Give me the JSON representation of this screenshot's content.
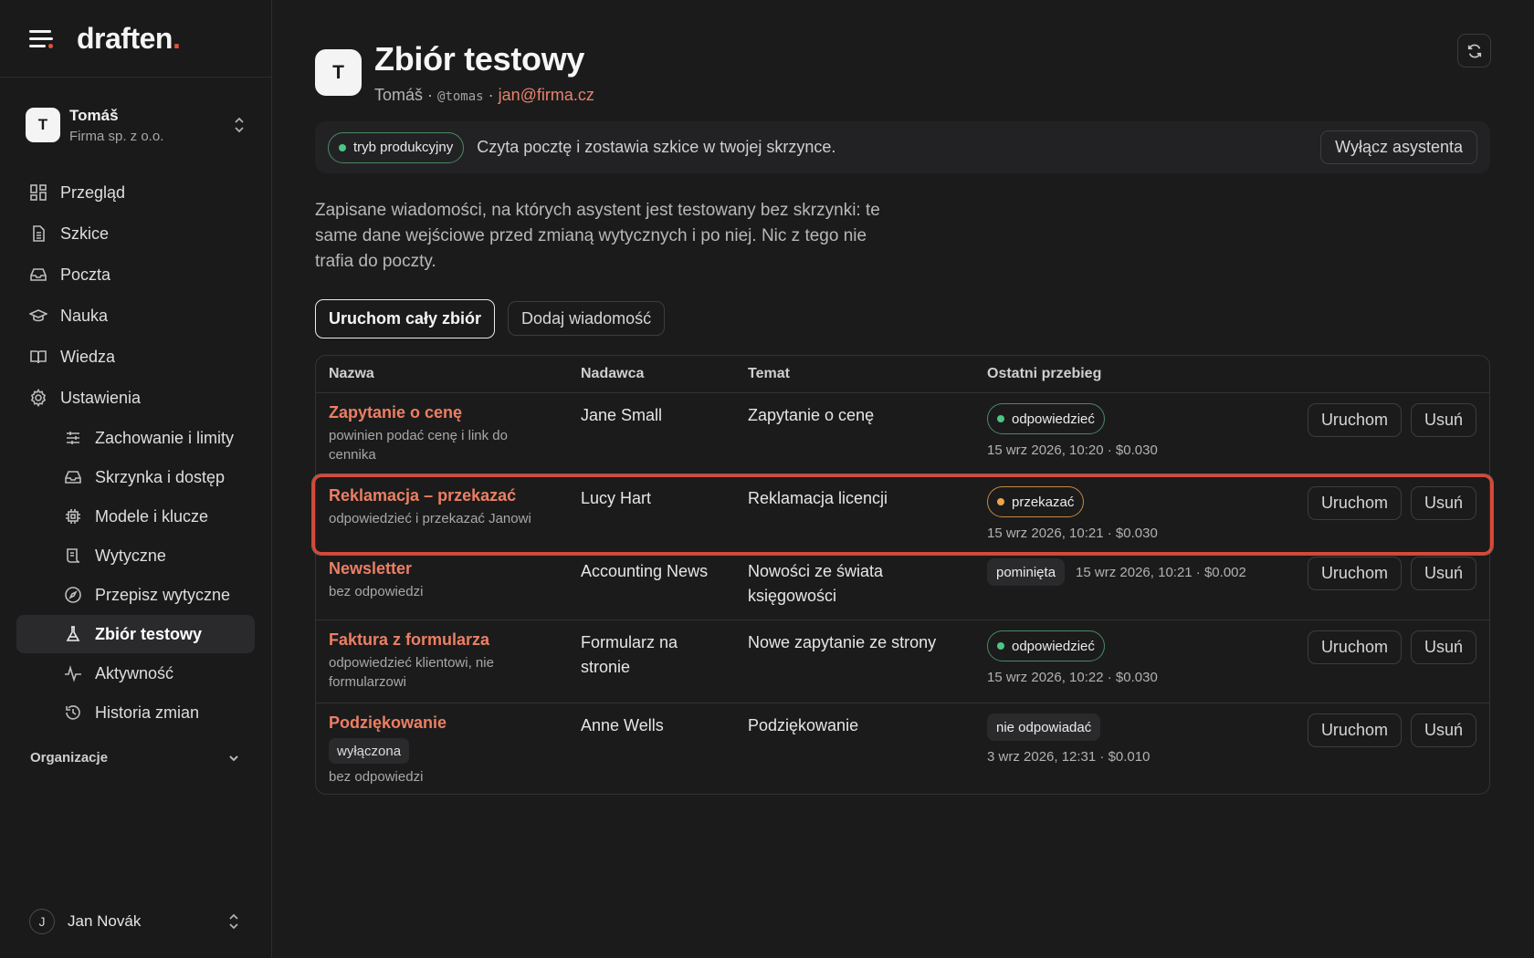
{
  "brand": {
    "name": "draften",
    "dot": "."
  },
  "account": {
    "initial": "T",
    "name": "Tomáš",
    "company": "Firma sp. z o.o."
  },
  "nav": [
    {
      "label": "Przegląd",
      "icon": "grid-icon"
    },
    {
      "label": "Szkice",
      "icon": "file-icon"
    },
    {
      "label": "Poczta",
      "icon": "inbox-icon"
    },
    {
      "label": "Nauka",
      "icon": "graduation-icon"
    },
    {
      "label": "Wiedza",
      "icon": "book-icon"
    },
    {
      "label": "Ustawienia",
      "icon": "gear-icon"
    }
  ],
  "subnav": [
    {
      "label": "Zachowanie i limity",
      "icon": "sliders-icon"
    },
    {
      "label": "Skrzynka i dostęp",
      "icon": "inbox-icon"
    },
    {
      "label": "Modele i klucze",
      "icon": "chip-icon"
    },
    {
      "label": "Wytyczne",
      "icon": "scroll-icon"
    },
    {
      "label": "Przepisz wytyczne",
      "icon": "compass-icon"
    },
    {
      "label": "Zbiór testowy",
      "icon": "flask-icon"
    },
    {
      "label": "Aktywność",
      "icon": "activity-icon"
    },
    {
      "label": "Historia zmian",
      "icon": "history-icon"
    }
  ],
  "org_label": "Organizacje",
  "user": {
    "initial": "J",
    "name": "Jan Novák"
  },
  "page": {
    "initial": "T",
    "title": "Zbiór testowy",
    "owner": "Tomáš",
    "sep": " · ",
    "handle": "@tomas",
    "email": "jan@firma.cz"
  },
  "banner": {
    "mode": "tryb produkcyjny",
    "text": "Czyta pocztę i zostawia szkice w twojej skrzynce.",
    "button": "Wyłącz asystenta"
  },
  "description": "Zapisane wiadomości, na których asystent jest testowany bez skrzynki: te same dane wejściowe przed zmianą wytycznych i po niej. Nic z tego nie trafia do poczty.",
  "actions": {
    "run_all": "Uruchom cały zbiór",
    "add": "Dodaj wiadomość"
  },
  "table": {
    "headers": [
      "Nazwa",
      "Nadawca",
      "Temat",
      "Ostatni przebieg"
    ],
    "run_label": "Uruchom",
    "delete_label": "Usuń",
    "rows": [
      {
        "name": "Zapytanie o cenę",
        "note": "powinien podać cenę i link do cennika",
        "sender": "Jane Small",
        "subject": "Zapytanie o cenę",
        "status": "odpowiedzieć",
        "when": "15 wrz 2026, 10:20 · $0.030"
      },
      {
        "name": "Reklamacja – przekazać",
        "note": "odpowiedzieć i przekazać Janowi",
        "sender": "Lucy Hart",
        "subject": "Reklamacja licencji",
        "status": "przekazać",
        "when": "15 wrz 2026, 10:21 · $0.030"
      },
      {
        "name": "Newsletter",
        "note": "bez odpowiedzi",
        "sender": "Accounting News",
        "subject": "Nowości ze świata księgowości",
        "status": "pominięta",
        "when": "15 wrz 2026, 10:21 · $0.002"
      },
      {
        "name": "Faktura z formularza",
        "note": "odpowiedzieć klientowi, nie formularzowi",
        "sender": "Formularz na stronie",
        "subject": "Nowe zapytanie ze strony",
        "status": "odpowiedzieć",
        "when": "15 wrz 2026, 10:22 · $0.030"
      },
      {
        "name": "Podziękowanie",
        "tag": "wyłączona",
        "note": "bez odpowiedzi",
        "sender": "Anne Wells",
        "subject": "Podziękowanie",
        "status": "nie odpowiadać",
        "when": "3 wrz 2026, 12:31 · $0.010"
      }
    ]
  },
  "colors": {
    "accent": "#ec7f63",
    "brand_dot": "#e25438",
    "status_green": "#4cc683",
    "status_orange": "#f0a34a",
    "highlight": "#e04632"
  }
}
